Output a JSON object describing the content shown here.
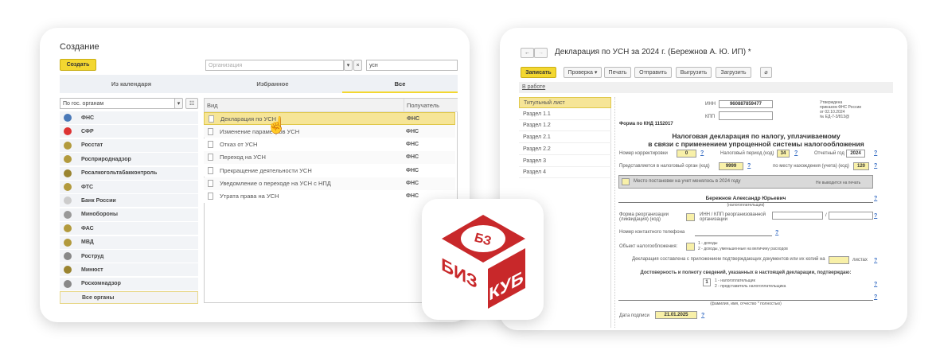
{
  "left": {
    "title": "Создание",
    "create_label": "Создать",
    "org_placeholder": "Организация",
    "search_value": "усн",
    "tabs": [
      {
        "label": "Из календаря"
      },
      {
        "label": "Избранное"
      },
      {
        "label": "Все",
        "active": true
      }
    ],
    "filter_value": "По гос. органам",
    "agencies": [
      "ФНС",
      "СФР",
      "Росстат",
      "Росприроднадзор",
      "Росалкогольтабакконтроль",
      "ФТС",
      "Банк России",
      "Минобороны",
      "ФАС",
      "МВД",
      "Роструд",
      "Минюст",
      "Роскомнадзор",
      "Все органы"
    ],
    "columns": [
      "Вид",
      "Получатель"
    ],
    "rows": [
      {
        "name": "Декларация по УСН",
        "recipient": "ФНС",
        "selected": true
      },
      {
        "name": "Изменение параметров УСН",
        "recipient": "ФНС"
      },
      {
        "name": "Отказ от УСН",
        "recipient": "ФНС"
      },
      {
        "name": "Переход на УСН",
        "recipient": "ФНС"
      },
      {
        "name": "Прекращение деятельности УСН",
        "recipient": "ФНС"
      },
      {
        "name": "Уведомление о переходе на УСН с НПД",
        "recipient": "ФНС"
      },
      {
        "name": "Утрата права на УСН",
        "recipient": "ФНС"
      }
    ]
  },
  "logo": {
    "text_top": "БЗ",
    "text_left": "БИЗ",
    "text_right": "КУБ",
    "color": "#c8282a"
  },
  "right": {
    "title": "Декларация по УСН за 2024 г. (Бережнов А. Ю. ИП) *",
    "toolbar": {
      "save": "Записать",
      "check": "Проверка",
      "print": "Печать",
      "send": "Отправить",
      "export": "Выгрузить",
      "import": "Загрузить"
    },
    "status": "В работе",
    "sections": [
      "Титульный лист",
      "Раздел 1.1",
      "Раздел 1.2",
      "Раздел 2.1",
      "Раздел 2.2",
      "Раздел 3",
      "Раздел 4"
    ],
    "form": {
      "inn_label": "ИНН",
      "inn": "960887859477",
      "kpp_label": "КПП",
      "approved": [
        "Утверждена",
        "приказом ФНС России",
        "от 02.10.2024",
        "№ ЕД-7-3/813@"
      ],
      "knd": "Форма по КНД 1152017",
      "heading1": "Налоговая декларация по налогу, уплачиваемому",
      "heading2": "в связи с применением упрощенной системы налогообложения",
      "corr_label": "Номер корректировки",
      "corr": "0",
      "period_label": "Налоговый период (код)",
      "period": "34",
      "year_label": "Отчетный год",
      "year": "2024",
      "authority_label": "Представляется в налоговый орган (код)",
      "authority": "9999",
      "location_label": "по месту нахождения (учета) (код)",
      "location": "120",
      "changed_label": "Место постановки на учет менялось в 2024 году",
      "not_printed": "Не выводится на печать",
      "taxpayer": "Бережнов Александр Юрьевич",
      "taxpayer_caption": "(налогоплательщик)",
      "reorg_label": "Форма реорганизации (ликвидация) (код)",
      "reorg_inn_label": "ИНН / КПП реорганизованной организации",
      "phone_label": "Номер контактного телефона",
      "object_label": "Объект налогообложения:",
      "object_opt1": "1 - доходы",
      "object_opt2": "2 - доходы, уменьшенные на величину расходов",
      "attach_label": "Декларация составлена с приложением подтверждающих документов или их копий на",
      "sheets": "листах",
      "confirm_label": "Достоверность и полноту сведений, указанных в настоящей декларации, подтверждаю:",
      "confirm_value": "1",
      "confirm_opt1": "1 - налогоплательщик",
      "confirm_opt2": "2 - представитель налогоплательщика",
      "fio_caption": "(фамилия, имя, отчество * полностью)",
      "date_label": "Дата подписи",
      "date": "21.01.2025",
      "help": "?"
    }
  },
  "colors": {
    "accent": "#f3d730",
    "selected_row": "#f6e597",
    "logo_red": "#c8282a"
  }
}
